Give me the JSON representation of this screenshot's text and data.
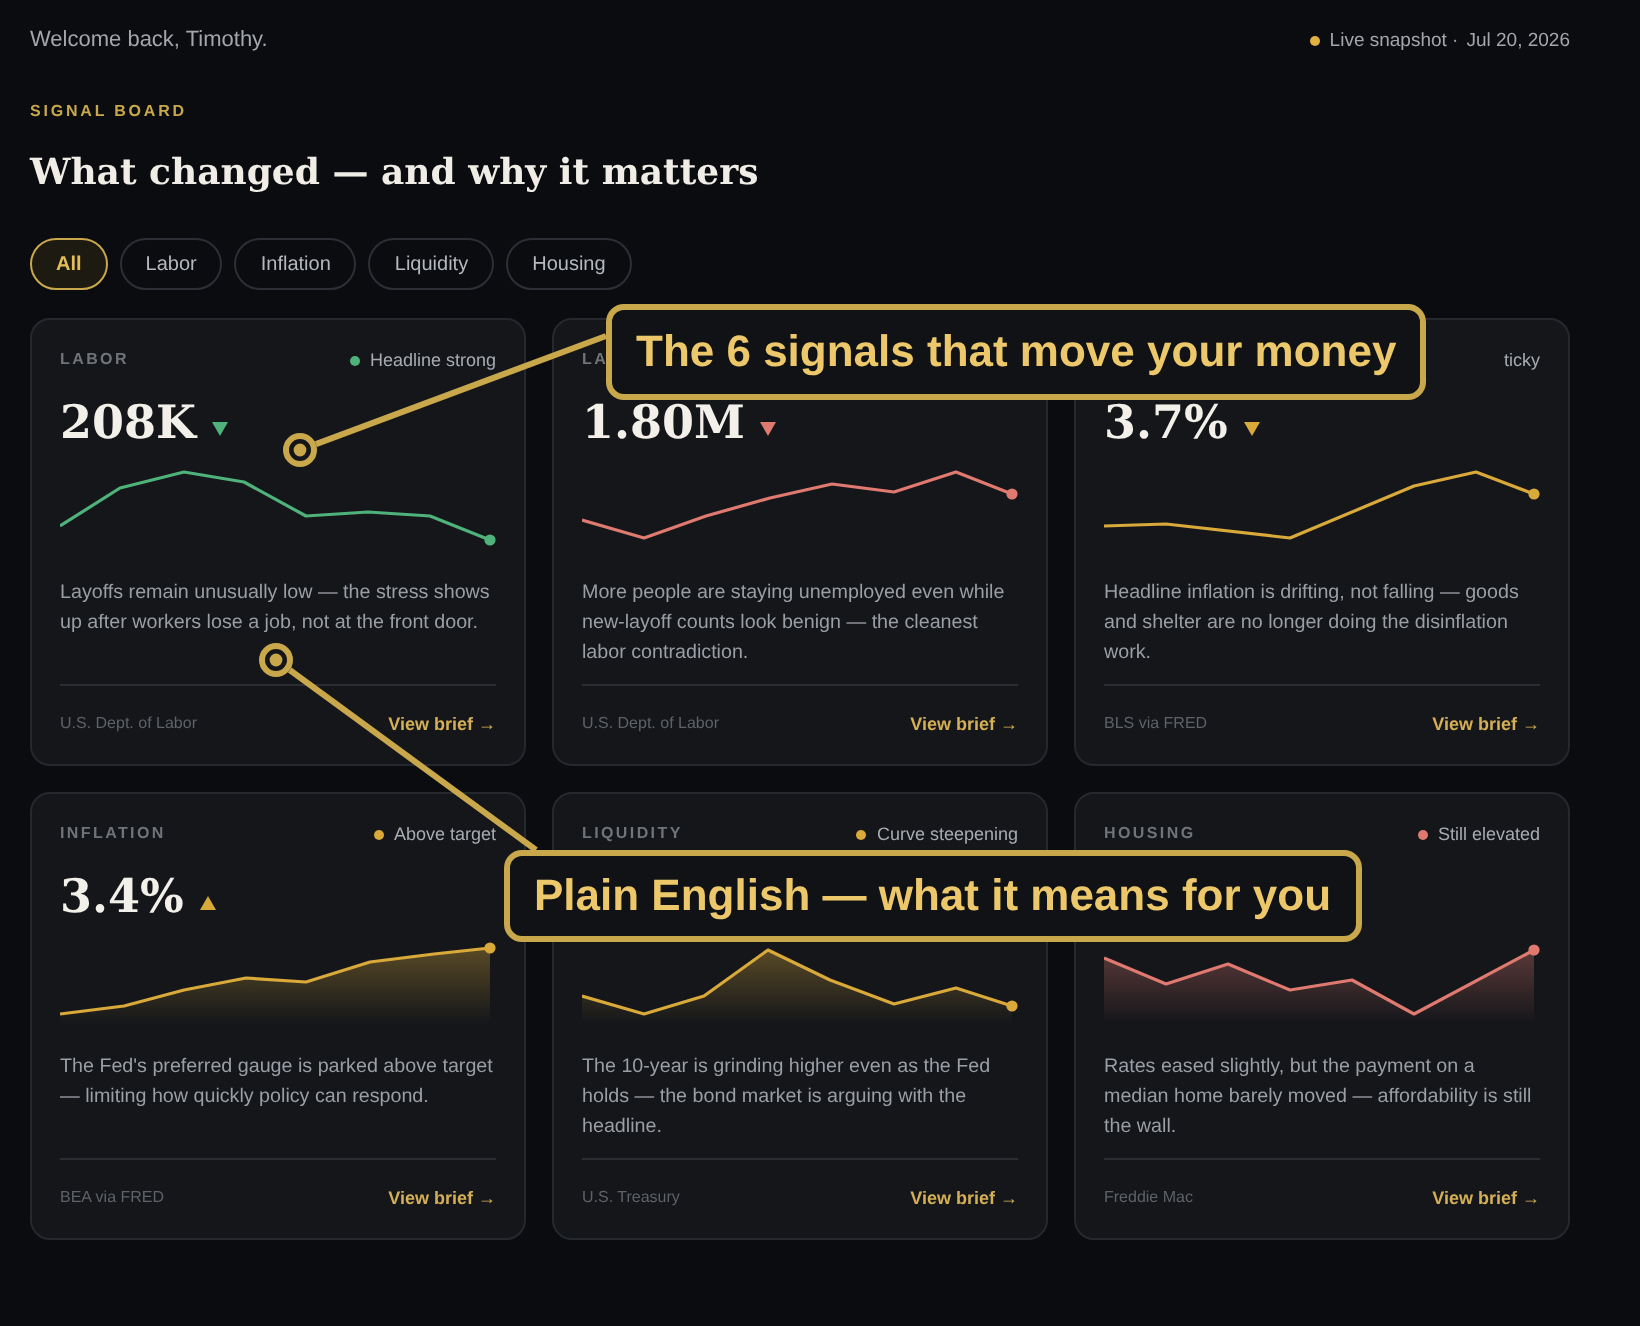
{
  "header": {
    "greeting": "Welcome back, Timothy.",
    "live": {
      "text": "Live snapshot ·",
      "date": "Jul 20, 2026",
      "color": "#e0b040"
    }
  },
  "eyebrow": "SIGNAL BOARD",
  "title": "What changed — and why it matters",
  "filters": [
    {
      "label": "All",
      "selected": true
    },
    {
      "label": "Labor",
      "selected": false
    },
    {
      "label": "Inflation",
      "selected": false
    },
    {
      "label": "Liquidity",
      "selected": false
    },
    {
      "label": "Housing",
      "selected": false
    }
  ],
  "cards": [
    {
      "kind": "line",
      "label": "LABOR",
      "status": {
        "text": "Headline strong",
        "color": "#4fb27a"
      },
      "value": "208K",
      "rising": false,
      "color": "#4fb27a",
      "description": "Layoffs remain unusually low — the stress shows up after workers lose a job, not at the front door.",
      "source": "U.S. Dept. of Labor",
      "link": "View brief →"
    },
    {
      "kind": "line",
      "label": "LA",
      "value": "1.80M",
      "rising": false,
      "color": "#e07a70",
      "description": "More people are staying unemployed even while new-layoff counts look benign — the cleanest labor contradiction.",
      "source": "U.S. Dept. of Labor",
      "link": "View brief →"
    },
    {
      "kind": "line",
      "status": {
        "text": "ticky"
      },
      "value": "3.7%",
      "rising": false,
      "color": "#d9a93a",
      "description": "Headline inflation is drifting, not falling — goods and shelter are no longer doing the disinflation work.",
      "source": "BLS via FRED",
      "link": "View brief →"
    },
    {
      "kind": "area",
      "label": "INFLATION",
      "status": {
        "text": "Above target",
        "color": "#d9a93a"
      },
      "value": "3.4%",
      "rising": true,
      "color": "#d9a93a",
      "description": "The Fed's preferred gauge is parked above target — limiting how quickly policy can respond.",
      "source": "BEA via FRED",
      "link": "View brief →"
    },
    {
      "kind": "area",
      "label": "LIQUIDITY",
      "status": {
        "text": "Curve steepening",
        "color": "#d9a93a"
      },
      "color": "#d9a93a",
      "description": "The 10-year is grinding higher even as the Fed holds — the bond market is arguing with the headline.",
      "source": "U.S. Treasury",
      "link": "View brief →"
    },
    {
      "kind": "area",
      "label": "HOUSING",
      "status": {
        "text": "Still elevated",
        "color": "#e07a70"
      },
      "color": "#e07a70",
      "description": "Rates eased slightly, but the payment on a median home barely moved — affordability is still the wall.",
      "source": "Freddie Mac",
      "link": "View brief →"
    }
  ],
  "annotations": [
    {
      "text": "The 6 signals that move your money"
    },
    {
      "text": "Plain English — what it means for you"
    }
  ]
}
